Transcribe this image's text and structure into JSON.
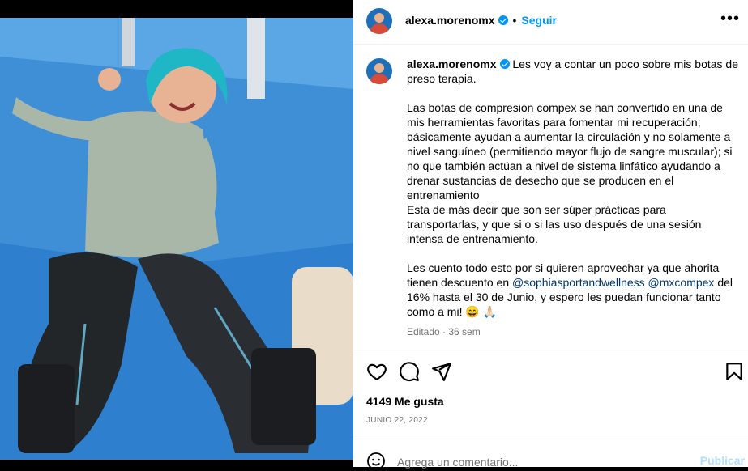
{
  "post": {
    "username": "alexa.morenomx",
    "follow_label": "Seguir",
    "dot": "•",
    "more_label": "•••",
    "caption_parts": {
      "intro": "Les voy a contar un poco sobre mis botas de preso terapia.",
      "body": "\n\nLas botas de compresión compex se han convertido en una de mis herramientas favoritas para fomentar mi recuperación; básicamente ayudan a aumentar la circulación y no solamente a nivel sanguíneo (permitiendo mayor flujo de sangre muscular); si no que también actúan a nivel de sistema linfático ayudando a drenar sustancias de desecho que se producen en el entrenamiento\nEsta de más decir que son ser súper prácticas para transportarlas, y que si o si las uso después de una sesión intensa de entrenamiento.\n\nLes cuento todo esto por si quieren aprovechar ya que ahorita tienen descuento en ",
      "mention1": "@sophiasportandwellness",
      "space": " ",
      "mention2": "@mxcompex",
      "tail": " del 16% hasta el 30 de Junio, y espero les puedan funcionar tanto como a mi! 😄 🙏🏻"
    },
    "edited_label": "Editado",
    "age": "36 sem",
    "likes_text": "4149 Me gusta",
    "date_text": "JUNIO 22, 2022",
    "comment_placeholder": "Agrega un comentario...",
    "publish_label": "Publicar"
  },
  "icons": {
    "like": "heart-icon",
    "comment": "comment-icon",
    "share": "send-icon",
    "save": "bookmark-icon",
    "emoji": "emoji-icon"
  },
  "colors": {
    "accent": "#0095f6",
    "mention": "#00376b",
    "secondary_text": "#737373",
    "publish_disabled": "#b2dffc"
  }
}
